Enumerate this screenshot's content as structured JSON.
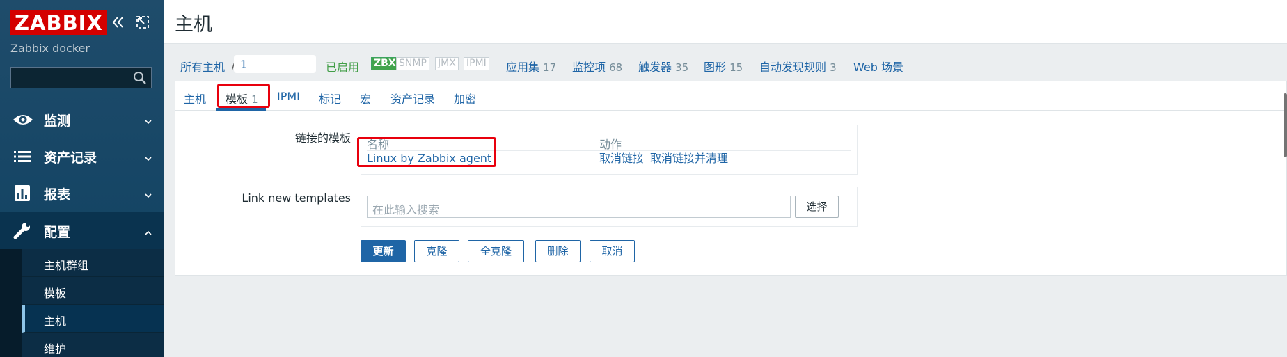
{
  "sidebar": {
    "logo": "ZABBIX",
    "server_name": "Zabbix docker",
    "search_value": "",
    "menu": [
      {
        "label": "监测",
        "icon": "eye-icon",
        "expanded": false
      },
      {
        "label": "资产记录",
        "icon": "list-icon",
        "expanded": false
      },
      {
        "label": "报表",
        "icon": "bar-chart-icon",
        "expanded": false
      },
      {
        "label": "配置",
        "icon": "wrench-icon",
        "expanded": true
      }
    ],
    "submenu": [
      {
        "label": "主机群组"
      },
      {
        "label": "模板"
      },
      {
        "label": "主机",
        "selected": true
      },
      {
        "label": "维护"
      }
    ]
  },
  "header": {
    "title": "主机"
  },
  "host_nav": {
    "all_hosts": "所有主机",
    "separator": "/",
    "host_name": "1",
    "status": "已启用",
    "availability": [
      "ZBX",
      "SNMP",
      "JMX",
      "IPMI"
    ],
    "links": [
      {
        "label": "应用集",
        "count": "17"
      },
      {
        "label": "监控项",
        "count": "68"
      },
      {
        "label": "触发器",
        "count": "35"
      },
      {
        "label": "图形",
        "count": "15"
      },
      {
        "label": "自动发现规则",
        "count": "3"
      },
      {
        "label": "Web 场景",
        "count": ""
      }
    ]
  },
  "tabs": [
    {
      "label": "主机",
      "count": ""
    },
    {
      "label": "模板",
      "count": "1",
      "active": true
    },
    {
      "label": "IPMI",
      "count": ""
    },
    {
      "label": "标记",
      "count": ""
    },
    {
      "label": "宏",
      "count": ""
    },
    {
      "label": "资产记录",
      "count": ""
    },
    {
      "label": "加密",
      "count": ""
    }
  ],
  "form": {
    "linked_templates_label": "链接的模板",
    "col_name": "名称",
    "col_action": "动作",
    "linked_template": "Linux by Zabbix agent",
    "unlink": "取消链接",
    "unlink_and_clear": "取消链接并清理",
    "link_new_label": "Link new templates",
    "search_placeholder": "在此输入搜索",
    "select_button": "选择"
  },
  "buttons": {
    "update": "更新",
    "clone": "克隆",
    "full_clone": "全克隆",
    "delete": "删除",
    "cancel": "取消"
  },
  "colors": {
    "sidebar_bg": "#1f4c6b",
    "logo_red": "#d40000",
    "link_blue": "#1f65a6",
    "enabled_green": "#429e47",
    "highlight_red": "#e8000d"
  }
}
